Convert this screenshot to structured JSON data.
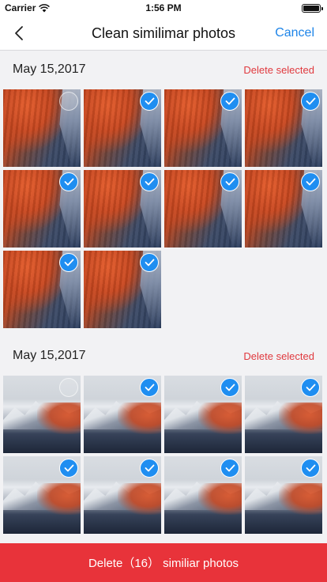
{
  "status_bar": {
    "carrier": "Carrier",
    "time": "1:56 PM",
    "icons": [
      "wifi-icon",
      "battery-icon"
    ]
  },
  "nav": {
    "back_icon": "chevron-left-icon",
    "title": "Clean similimar photos",
    "cancel_label": "Cancel"
  },
  "groups": [
    {
      "date": "May 15,2017",
      "delete_label": "Delete selected",
      "photo_kind": "sunset",
      "selected": [
        false,
        true,
        true,
        true,
        true,
        true,
        true,
        true,
        true,
        true
      ]
    },
    {
      "date": "May 15,2017",
      "delete_label": "Delete selected",
      "photo_kind": "snow",
      "selected": [
        false,
        true,
        true,
        true,
        true,
        true,
        true,
        true
      ]
    }
  ],
  "delete_button": {
    "label": "Delete（16） similiar photos"
  },
  "colors": {
    "accent": "#1f8ef1",
    "delete_red": "#e8333a",
    "link_blue": "#1d84e8",
    "background": "#f2f2f4"
  }
}
